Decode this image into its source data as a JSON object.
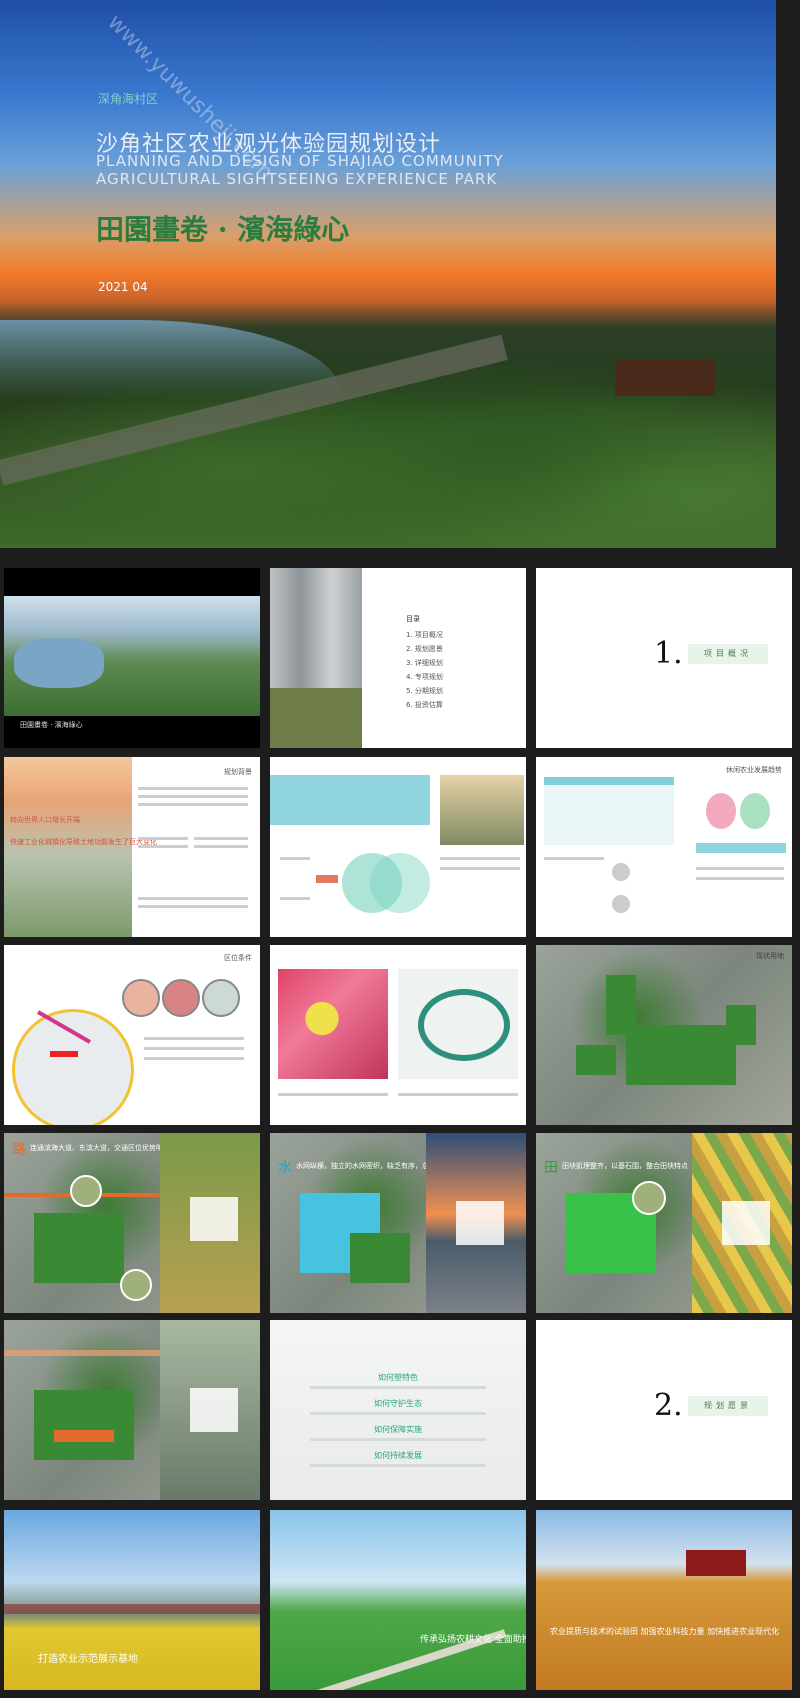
{
  "cover": {
    "kicker": "深角海村区",
    "title": "沙角社区农业观光体验园规划设计",
    "en_line1": "PLANNING AND DESIGN OF SHAJIAO COMMUNITY",
    "en_line2": "AGRICULTURAL SIGHTSEEING EXPERIENCE PARK",
    "slogan": "田園畫卷 · 濱海綠心",
    "date": "2021 04"
  },
  "watermark": "www.yuwusheji.com",
  "pages": {
    "p1_caption": "田園畫卷 · 濱海綠心",
    "toc_title": "目录",
    "toc_items": [
      "1. 项目概况",
      "2. 规划愿景",
      "3. 详细规划",
      "4. 专项规划",
      "5. 分期规划",
      "6. 投资估算"
    ],
    "section1_num": "1.",
    "section1_label": "项目概况",
    "section2_num": "2.",
    "section2_label": "规划愿景",
    "p4_header": "规划背景",
    "p4_lines": [
      "转向世界人口增长开端",
      "快速工业化城镇化导致土地功能发生了巨大变化"
    ],
    "p6_header": "休闲农业发展趋势",
    "p7_header": "区位条件",
    "p9_header": "现状用地",
    "road_title": "路",
    "road_text": "连通滨海大道、东滨大道，交通区位优势明显",
    "water_title": "水",
    "water_text": "水网纵横，独立的水网密织，缺乏有序，总体生态质量不高",
    "field_title": "田",
    "field_text": "田块肌理整齐，以基石围，整合田块特点",
    "q_title1": "如何塑特色",
    "q_title2": "如何守护生态",
    "q_title3": "如何保障实施",
    "q_title4": "如何持续发展",
    "banner1": "打造农业示范展示基地",
    "banner2": "传承弘扬农耕文化 全面助推乡村振兴",
    "banner3": "农业提质与技术的试验田 加强农业科技力量 加快推进农业现代化"
  },
  "colors": {
    "accent_green": "#2b7d3f",
    "tag_bg": "#e8f4ea"
  }
}
